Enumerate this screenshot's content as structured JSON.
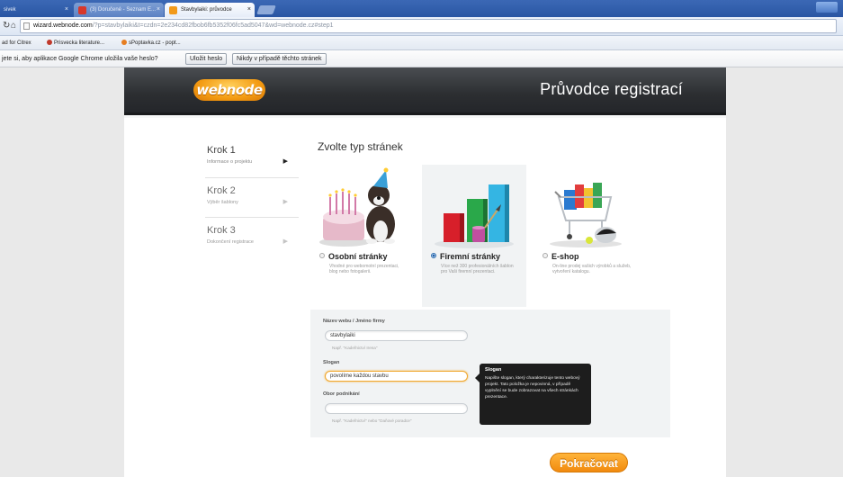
{
  "browser": {
    "tabs": [
      {
        "label": "sivek",
        "close": "×"
      },
      {
        "label": "(3) Doručené - Seznam E...",
        "close": "×"
      },
      {
        "label": "Stavbylaiki: průvodce",
        "close": "×"
      }
    ],
    "url_main": "wizard.webnode.com",
    "url_rest": "/?p=stavbylaiki&t=czdn=2e234cd82fbob6fb5352f06fc5ad5047&wd=webnode.cz#step1",
    "bookmarks": [
      {
        "label": "ad for Citrex"
      },
      {
        "label": "Prisvecka literature..."
      },
      {
        "label": "sPoptavka.cz - popt..."
      }
    ],
    "infobar": {
      "message": "jete si, aby aplikace Google Chrome uložila vaše heslo?",
      "save_btn": "Uložit heslo",
      "never_btn": "Nikdy v případě těchto stránek"
    }
  },
  "header": {
    "logo": "webnode",
    "title": "Průvodce registrací"
  },
  "steps": [
    {
      "title": "Krok 1",
      "subtitle": "Informace o projektu",
      "arrow": "▶",
      "active": true
    },
    {
      "title": "Krok 2",
      "subtitle": "Výběr šablony",
      "arrow": "▶",
      "active": false
    },
    {
      "title": "Krok 3",
      "subtitle": "Dokončení registrace",
      "arrow": "▶",
      "active": false
    }
  ],
  "choose_title": "Zvolte typ stránek",
  "site_types": [
    {
      "label": "Osobní stránky",
      "desc": "Vhodné pro webomotní prezentaci, blog nebo fotogalerii.",
      "selected": false
    },
    {
      "label": "Firemní stránky",
      "desc": "Více než 300 profesionálních šablon pro Vaši firemní prezentaci.",
      "selected": true
    },
    {
      "label": "E-shop",
      "desc": "On-line prodej vašich výrobků a služeb, vytvoření katalogu.",
      "selected": false
    }
  ],
  "form": {
    "name_label": "Název webu / Jméno firmy",
    "name_value": "stavbylaiki",
    "name_hint": "Např. \"Kadeřnictví Irena\"",
    "slogan_label": "Slogan",
    "slogan_value": "povolíme každou stavbu",
    "field_label": "Obor podnikání",
    "field_value": "",
    "field_hint": "Např. \"Kadeřnictví\" nebo \"Daňové poradce\""
  },
  "tooltip": {
    "title": "Slogan",
    "body": "Napište slogan, který charakterizuje tento webový projekt. Tato položka je nepovinná, v případě vyplnění se bude zobrazovat na všech stránkách prezentace."
  },
  "next_button": "Pokračovat",
  "colors": {
    "accent": "#f18a0e",
    "header_bg": "#2c2e31",
    "selected_radio": "#1e5ea8"
  }
}
